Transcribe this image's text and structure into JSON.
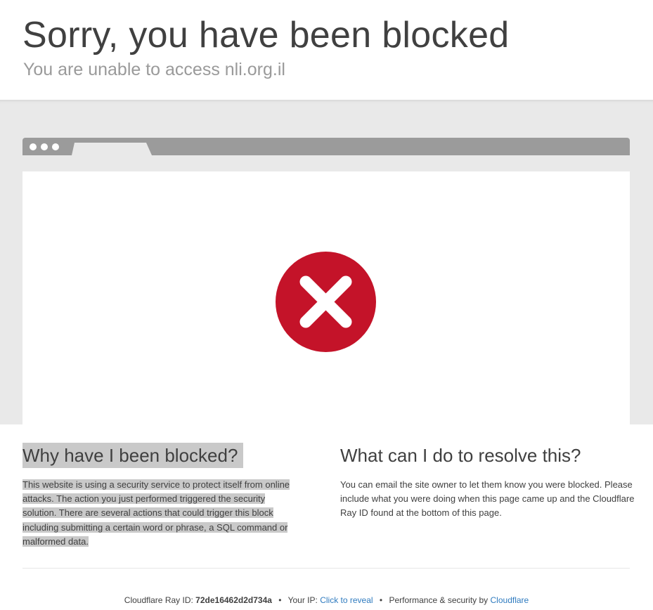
{
  "header": {
    "title": "Sorry, you have been blocked",
    "subtitle": "You are unable to access nli.org.il"
  },
  "illustration": {
    "icon": "error-x-circle-icon",
    "icon_color": "#c41329"
  },
  "why_section": {
    "heading": "Why have I been blocked?",
    "lines": [
      "This website is using a security service to protect itself from online",
      "attacks. The action you just performed triggered the security",
      "solution. There are several actions that could trigger this block",
      "including submitting a certain word or phrase, a SQL command or",
      "malformed data."
    ]
  },
  "resolve_section": {
    "heading": "What can I do to resolve this?",
    "text": "You can email the site owner to let them know you were blocked. Please include what you were doing when this page came up and the Cloudflare Ray ID found at the bottom of this page."
  },
  "footer": {
    "ray_label": "Cloudflare Ray ID:",
    "ray_id": "72de16462d2d734a",
    "separator": "•",
    "ip_label": "Your IP:",
    "ip_link": "Click to reveal",
    "perf_label": "Performance & security by",
    "perf_link": "Cloudflare"
  },
  "colors": {
    "highlight": "#c9c9c9",
    "link": "#2f7bbf",
    "band": "#e9e9e9",
    "browser_bar": "#9b9b9b"
  }
}
